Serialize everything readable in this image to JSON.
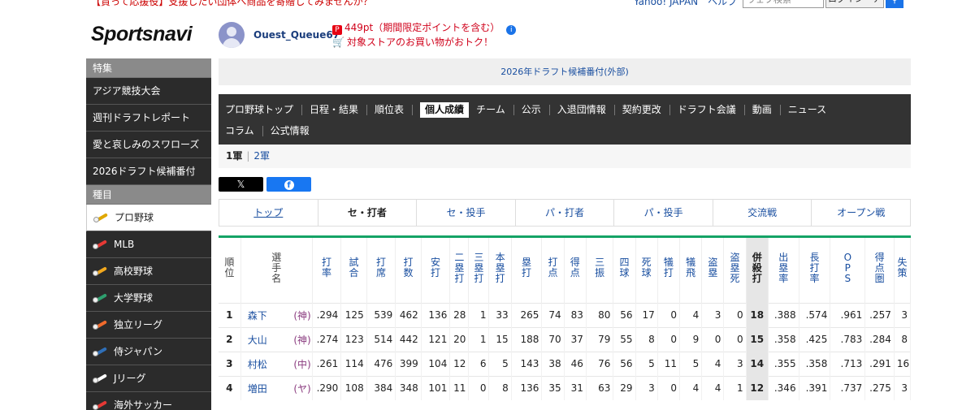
{
  "top_strip": {
    "promo": "【貰って応援役】支援したい団体へ商品を寄贈してみませんか？",
    "yahoo_links": "Yahoo! JAPAN　ヘルプ",
    "search_placeholder": "ウェブ検索",
    "search_button": "ログイン・アップ"
  },
  "header": {
    "logo": "Sportsnavi",
    "username": "Ouest_Queue67",
    "points": "449pt（期間限定ポイントを含む）",
    "store_promo": "対象ストアのお買い物がおトク！"
  },
  "sidebar": {
    "featured_heading": "特集",
    "featured": [
      "アジア競技大会",
      "週刊ドラフトレポート",
      "愛と哀しみのスワローズ",
      "2026ドラフト候補番付"
    ],
    "category_heading": "種目",
    "sports": [
      {
        "label": "プロ野球",
        "color": "#e0a800",
        "active": true
      },
      {
        "label": "MLB",
        "color": "#e53935",
        "active": false
      },
      {
        "label": "高校野球",
        "color": "#f2a81d",
        "active": false
      },
      {
        "label": "大学野球",
        "color": "#2e9f6e",
        "active": false
      },
      {
        "label": "独立リーグ",
        "color": "#f06a2c",
        "active": false
      },
      {
        "label": "侍ジャパン",
        "color": "#2f6fb8",
        "active": false
      },
      {
        "label": "Jリーグ",
        "color": "#ffffff",
        "active": false
      },
      {
        "label": "海外サッカー",
        "color": "#e53935",
        "active": false
      }
    ]
  },
  "banner": {
    "link": "2026年ドラフト候補番付(外部)"
  },
  "nav": {
    "row1": [
      "プロ野球トップ",
      "日程・結果",
      "順位表",
      "個人成績",
      "チーム",
      "公示",
      "入退団情報",
      "契約更改",
      "ドラフト会議",
      "動画",
      "ニュース"
    ],
    "row2": [
      "コラム",
      "公式情報"
    ],
    "active": "個人成績"
  },
  "subtabs": {
    "first": "1軍",
    "second": "2軍"
  },
  "share": {
    "x": "𝕏",
    "facebook": "f"
  },
  "stat_tabs": [
    "トップ",
    "セ・打者",
    "セ・投手",
    "パ・打者",
    "パ・投手",
    "交流戦",
    "オープン戦"
  ],
  "stat_tabs_active": "セ・打者",
  "table": {
    "headers": [
      "順位",
      "選手名",
      "打率",
      "試合",
      "打席",
      "打数",
      "安打",
      "二塁打",
      "三塁打",
      "本塁打",
      "塁打",
      "打点",
      "得点",
      "三振",
      "四球",
      "死球",
      "犠打",
      "犠飛",
      "盗塁",
      "盗塁死",
      "併殺打",
      "出塁率",
      "長打率",
      "OPS",
      "得点圏",
      "失策"
    ],
    "rows": [
      [
        "1",
        "森下",
        "(神)",
        ".294",
        "125",
        "539",
        "462",
        "136",
        "28",
        "1",
        "33",
        "265",
        "74",
        "83",
        "80",
        "56",
        "17",
        "0",
        "4",
        "3",
        "0",
        "18",
        ".388",
        ".574",
        ".961",
        ".257",
        "3"
      ],
      [
        "2",
        "大山",
        "(神)",
        ".274",
        "123",
        "514",
        "442",
        "121",
        "20",
        "1",
        "15",
        "188",
        "70",
        "37",
        "79",
        "55",
        "8",
        "0",
        "9",
        "0",
        "0",
        "15",
        ".358",
        ".425",
        ".783",
        ".284",
        "8"
      ],
      [
        "3",
        "村松",
        "(中)",
        ".261",
        "114",
        "476",
        "399",
        "104",
        "12",
        "6",
        "5",
        "143",
        "38",
        "46",
        "76",
        "56",
        "5",
        "11",
        "5",
        "4",
        "3",
        "14",
        ".355",
        ".358",
        ".713",
        ".291",
        "16"
      ],
      [
        "4",
        "増田",
        "(ヤ)",
        ".290",
        "108",
        "384",
        "348",
        "101",
        "11",
        "0",
        "8",
        "136",
        "35",
        "31",
        "63",
        "29",
        "3",
        "0",
        "4",
        "4",
        "1",
        "12",
        ".346",
        ".391",
        ".737",
        ".275",
        "3"
      ]
    ]
  }
}
